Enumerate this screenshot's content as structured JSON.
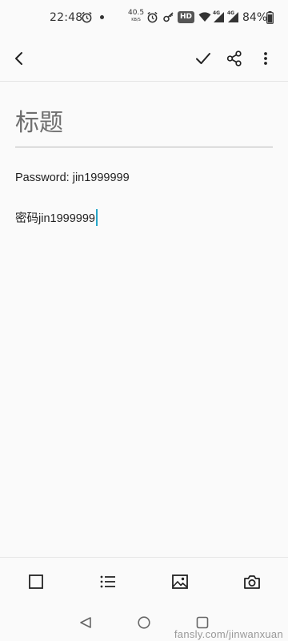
{
  "status_bar": {
    "time": "22:48",
    "net_speed_value": "40.5",
    "net_speed_unit": "KB/S",
    "hd_label": "HD",
    "network_1": "4G",
    "network_2": "4G",
    "battery_percent": "84%"
  },
  "toolbar": {
    "back_icon": "chevron-left",
    "save_icon": "check",
    "share_icon": "share",
    "more_icon": "more-vertical"
  },
  "editor": {
    "title_placeholder": "标题",
    "lines": [
      "Password: jin1999999",
      "密码jin1999999"
    ],
    "caret_color": "#26a6c9"
  },
  "format_bar": {
    "items": [
      "checkbox-icon",
      "bulleted-list-icon",
      "image-icon",
      "camera-icon"
    ]
  },
  "nav_bar": {
    "items": [
      "back-triangle",
      "home-circle",
      "recent-square"
    ]
  },
  "watermark": "fansly.com/jinwanxuan"
}
